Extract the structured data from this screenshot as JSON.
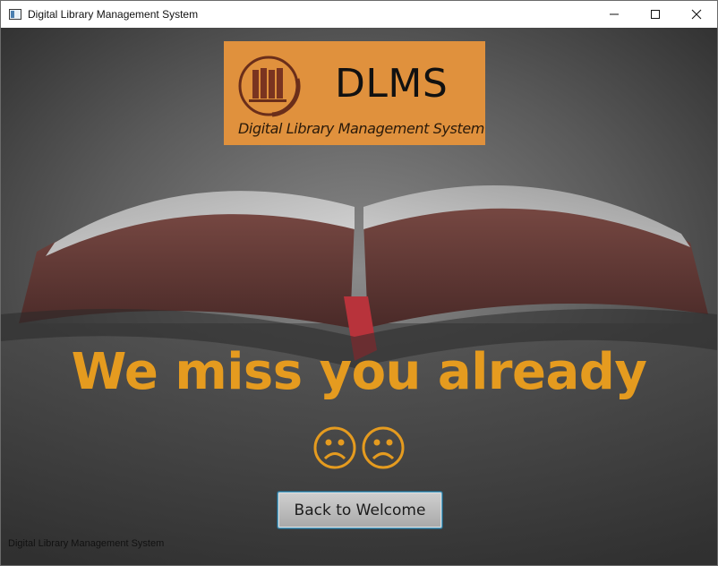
{
  "window": {
    "title": "Digital Library Management System",
    "controls": {
      "minimize_icon": "minimize-icon",
      "maximize_icon": "maximize-icon",
      "close_icon": "close-icon"
    }
  },
  "logo": {
    "abbreviation": "DLMS",
    "full_name": "Digital Library Management System",
    "background_color": "#e0913d",
    "emblem_icon": "books-emblem-icon"
  },
  "message": {
    "text": "We miss you already",
    "emoji": "☹☹",
    "color": "#e59b1f"
  },
  "actions": {
    "back_button_label": "Back to Welcome"
  },
  "footer": {
    "text": "Digital Library Management System"
  }
}
